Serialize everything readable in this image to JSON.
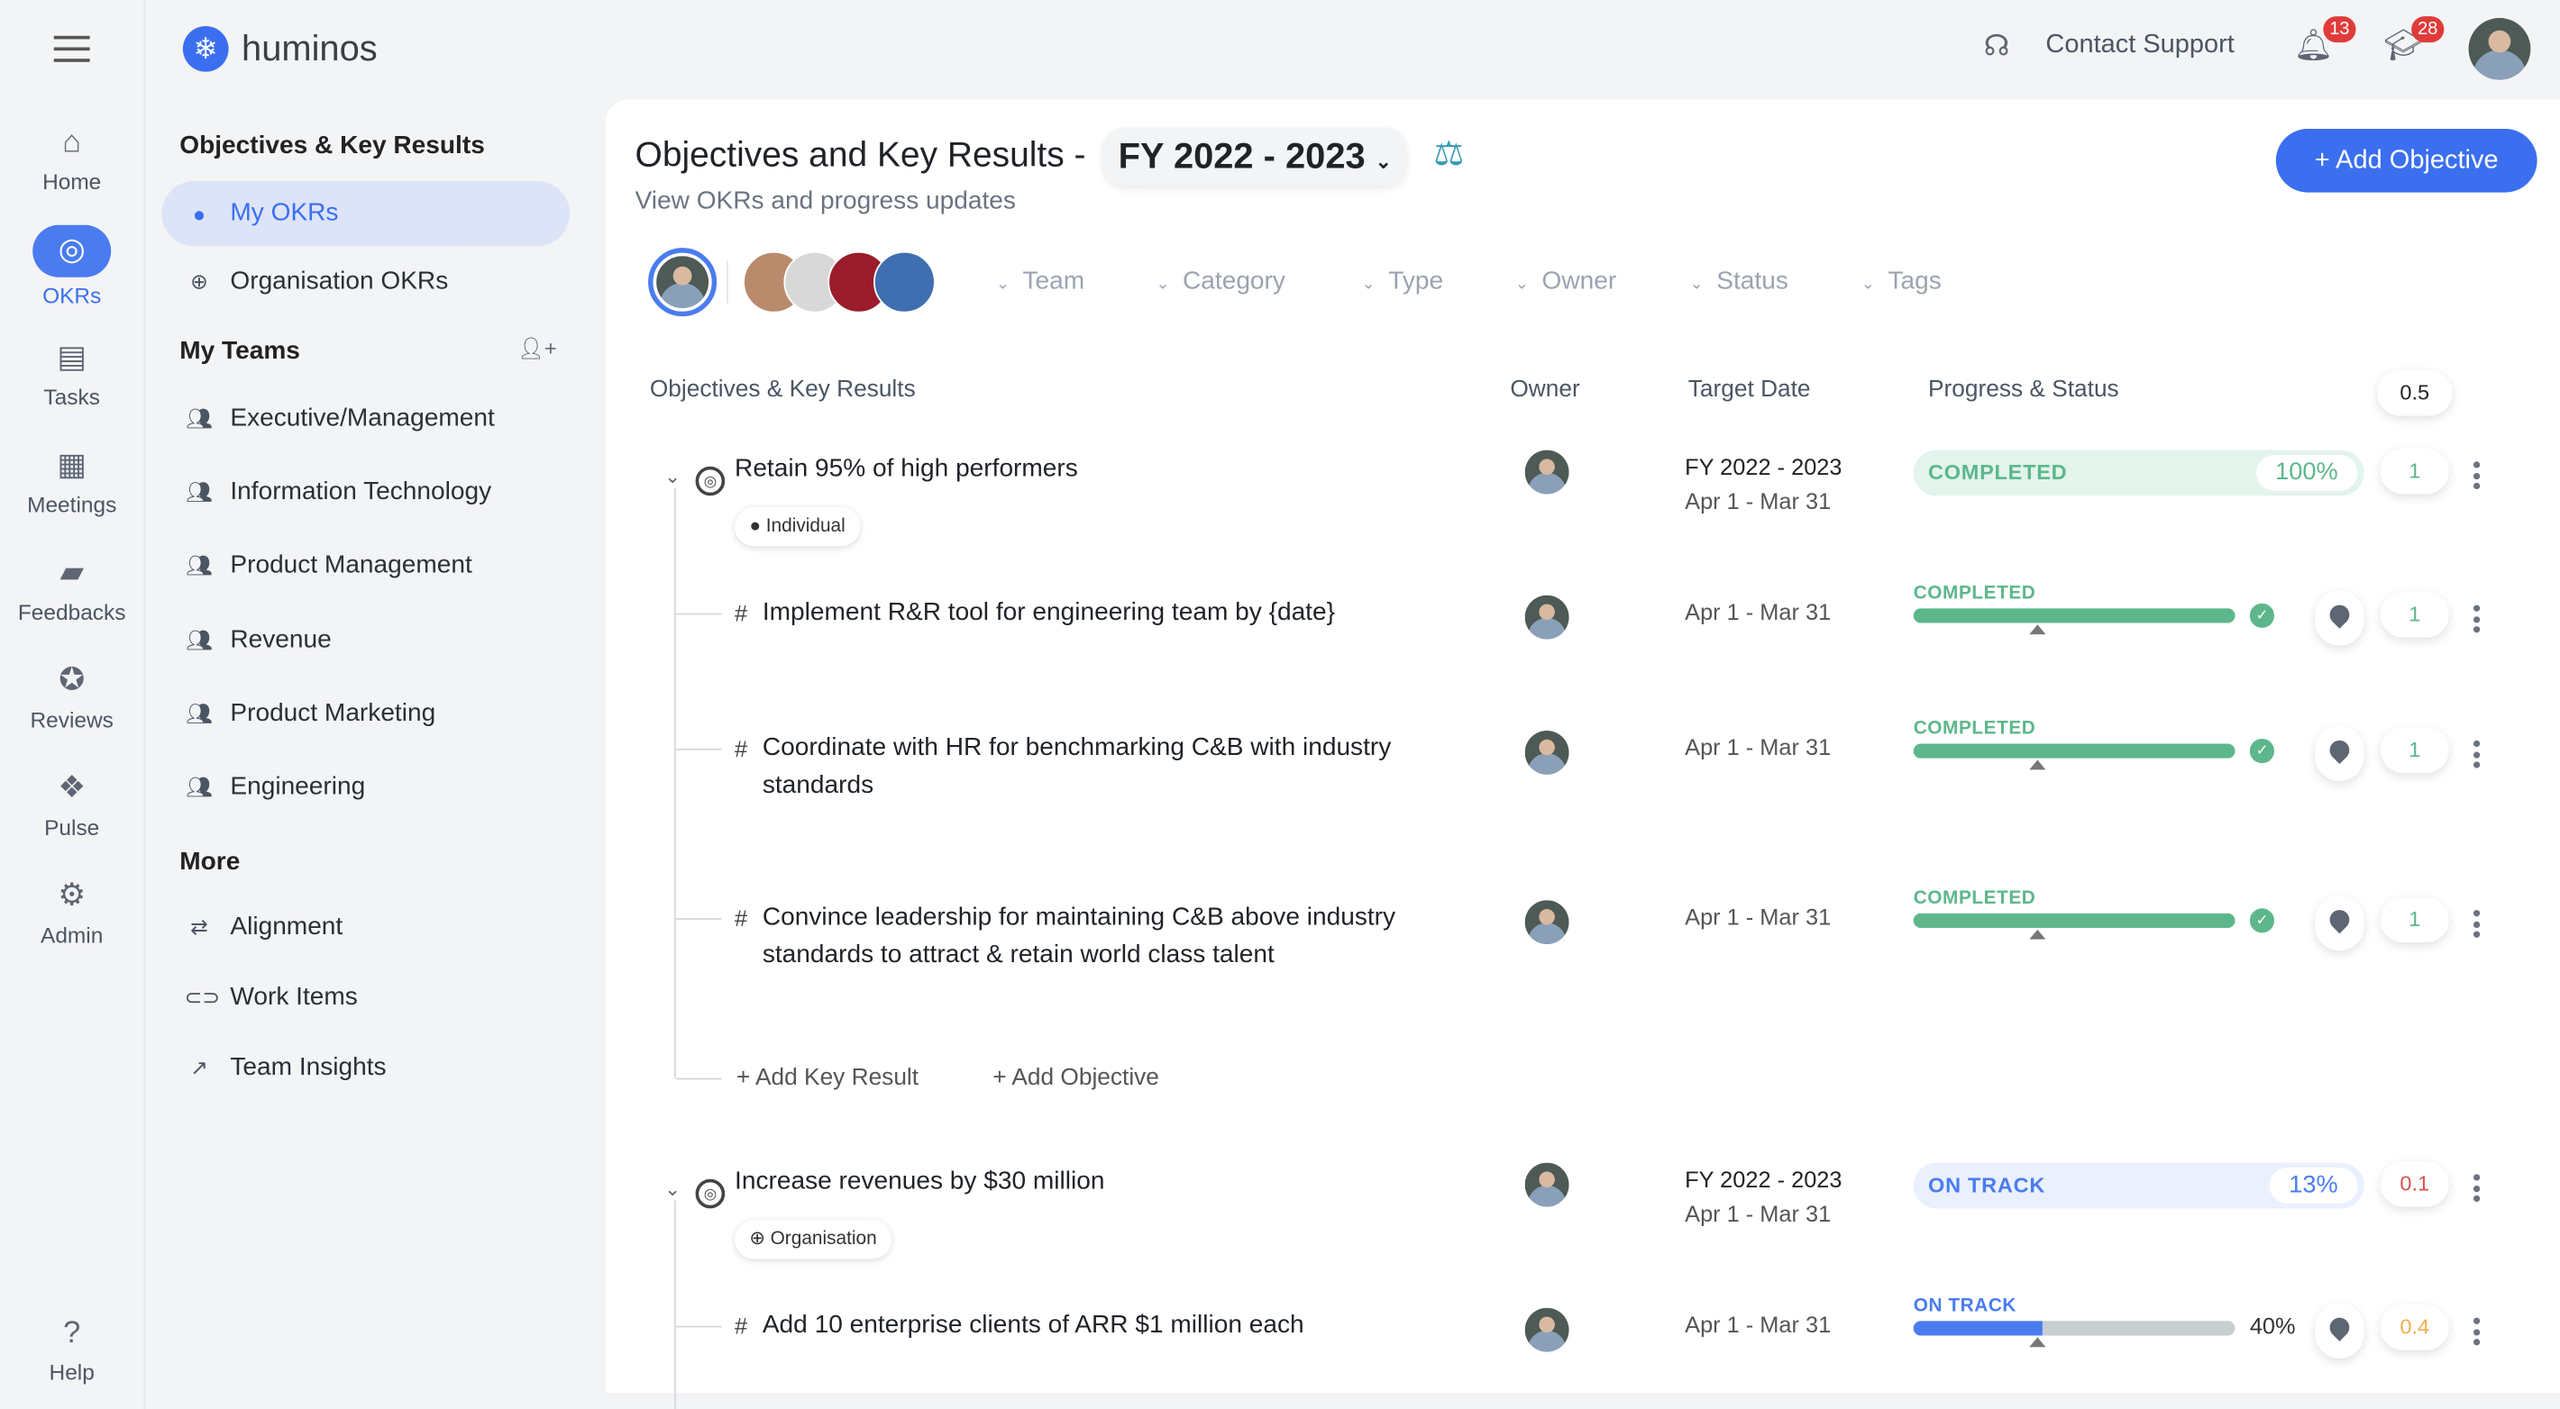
{
  "app": {
    "brand": "huminos"
  },
  "topbar": {
    "contact_support": "Contact Support",
    "notifications_count": "13",
    "learning_count": "28"
  },
  "rail": [
    {
      "label": "Home",
      "icon": "home-icon",
      "glyph": "⌂"
    },
    {
      "label": "OKRs",
      "icon": "target-icon",
      "glyph": "◎",
      "active": true
    },
    {
      "label": "Tasks",
      "icon": "task-icon",
      "glyph": "▤"
    },
    {
      "label": "Meetings",
      "icon": "calendar-icon",
      "glyph": "▦"
    },
    {
      "label": "Feedbacks",
      "icon": "feedback-icon",
      "glyph": "▰"
    },
    {
      "label": "Reviews",
      "icon": "star-icon",
      "glyph": "✪"
    },
    {
      "label": "Pulse",
      "icon": "pulse-icon",
      "glyph": "❖"
    },
    {
      "label": "Admin",
      "icon": "gear-icon",
      "glyph": "⚙"
    },
    {
      "label": "Help",
      "icon": "help-icon",
      "glyph": "?"
    }
  ],
  "sidebar": {
    "section_okr": "Objectives & Key Results",
    "okr_items": [
      {
        "label": "My OKRs",
        "icon": "user-icon",
        "glyph": "●",
        "active": true
      },
      {
        "label": "Organisation OKRs",
        "icon": "globe-icon",
        "glyph": "⊕"
      }
    ],
    "section_teams": "My Teams",
    "teams": [
      "Executive/Management",
      "Information Technology",
      "Product Management",
      "Revenue",
      "Product Marketing",
      "Engineering"
    ],
    "section_more": "More",
    "more_items": [
      {
        "label": "Alignment",
        "icon": "arrows-icon",
        "glyph": "⇄"
      },
      {
        "label": "Work Items",
        "icon": "link-icon",
        "glyph": "⊂⊃"
      },
      {
        "label": "Team Insights",
        "icon": "chart-icon",
        "glyph": "↗"
      }
    ]
  },
  "header": {
    "title": "Objectives and Key Results -",
    "period": "FY 2022 - 2023",
    "subtitle": "View OKRs and progress updates",
    "add_objective": "+ Add Objective"
  },
  "filters": [
    "Team",
    "Category",
    "Type",
    "Owner",
    "Status",
    "Tags"
  ],
  "columns": {
    "okr": "Objectives & Key Results",
    "owner": "Owner",
    "target": "Target Date",
    "progress": "Progress & Status",
    "score": "0.5"
  },
  "colors": {
    "accent": "#3b6ff0",
    "completed": "#5db78b",
    "on_track": "#4a7cf0",
    "score_red": "#d9534f",
    "score_orange": "#f0ad4e"
  },
  "objectives": [
    {
      "title": "Retain 95% of high performers",
      "tag": "Individual",
      "period": "FY 2022 - 2023",
      "range": "Apr 1 - Mar 31",
      "status": "COMPLETED",
      "progress": "100%",
      "score": "1",
      "key_results": [
        {
          "title": "Implement R&R tool for engineering team by {date}",
          "range": "Apr 1 - Mar 31",
          "status": "COMPLETED",
          "progress": 100,
          "score": "1"
        },
        {
          "title": "Coordinate with HR for benchmarking C&B with industry standards",
          "range": "Apr 1 - Mar 31",
          "status": "COMPLETED",
          "progress": 100,
          "score": "1"
        },
        {
          "title": "Convince leadership for maintaining C&B above industry standards to attract & retain world class talent",
          "range": "Apr 1 - Mar 31",
          "status": "COMPLETED",
          "progress": 100,
          "score": "1"
        }
      ],
      "add_key_result": "+  Add Key Result",
      "add_objective": "+  Add Objective"
    },
    {
      "title": "Increase revenues by $30 million",
      "tag": "Organisation",
      "period": "FY 2022 - 2023",
      "range": "Apr 1 - Mar 31",
      "status": "ON TRACK",
      "progress": "13%",
      "score": "0.1",
      "key_results": [
        {
          "title": "Add 10 enterprise clients of ARR $1 million each",
          "range": "Apr 1 - Mar 31",
          "status": "ON TRACK",
          "progress": 40,
          "progress_label": "40%",
          "score": "0.4"
        }
      ]
    }
  ]
}
